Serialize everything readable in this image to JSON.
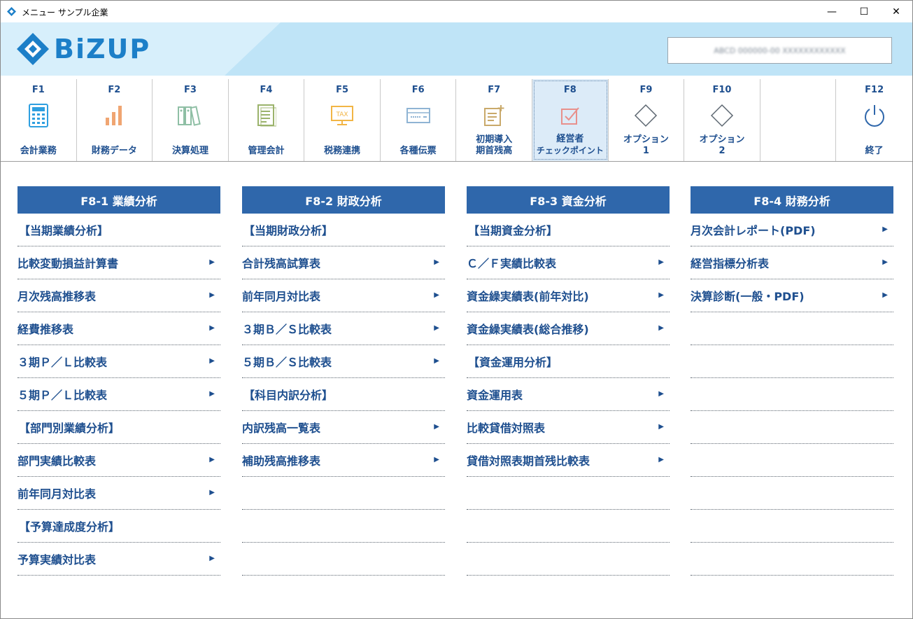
{
  "window": {
    "title": "メニュー サンプル企業",
    "controls": {
      "minimize": "—",
      "maximize": "☐",
      "close": "✕"
    }
  },
  "header": {
    "logo_text": "BiZUP",
    "user_info": "ABCD 000000-00 XXXXXXXXXXXX"
  },
  "fkeys": [
    {
      "key": "F1",
      "label": "会計業務",
      "icon": "calculator-icon"
    },
    {
      "key": "F2",
      "label": "財務データ",
      "icon": "bar-chart-icon"
    },
    {
      "key": "F3",
      "label": "決算処理",
      "icon": "binders-icon"
    },
    {
      "key": "F4",
      "label": "管理会計",
      "icon": "document-icon"
    },
    {
      "key": "F5",
      "label": "税務連携",
      "icon": "tax-monitor-icon"
    },
    {
      "key": "F6",
      "label": "各種伝票",
      "icon": "voucher-icon"
    },
    {
      "key": "F7",
      "label_line1": "初期導入",
      "label_line2": "期首残高",
      "icon": "list-add-icon"
    },
    {
      "key": "F8",
      "label_line1": "経営者",
      "label_line2": "チェックポイント",
      "icon": "checkbox-icon"
    },
    {
      "key": "F9",
      "label_line1": "オプション",
      "label_line2": "1",
      "icon": "diamond-icon"
    },
    {
      "key": "F10",
      "label_line1": "オプション",
      "label_line2": "2",
      "icon": "diamond-icon"
    },
    {
      "key": "F12",
      "label": "終了",
      "icon": "power-icon"
    }
  ],
  "colors": {
    "accent": "#2f67ab",
    "text": "#1e4f8f",
    "header_bg": "#bfe4f7",
    "active_bg": "#dcebf8"
  },
  "columns": [
    {
      "title": "F8-1 業績分析",
      "rows": [
        {
          "label": "【当期業績分析】",
          "section": true
        },
        {
          "label": "比較変動損益計算書",
          "arrow": "▶"
        },
        {
          "label": "月次残高推移表",
          "arrow": "▶"
        },
        {
          "label": "経費推移表",
          "arrow": "▶"
        },
        {
          "label": "３期Ｐ／Ｌ比較表",
          "arrow": "▶"
        },
        {
          "label": "５期Ｐ／Ｌ比較表",
          "arrow": "▶"
        },
        {
          "label": "【部門別業績分析】",
          "section": true
        },
        {
          "label": "部門実績比較表",
          "arrow": "▶"
        },
        {
          "label": "前年同月対比表",
          "arrow": "▶"
        },
        {
          "label": "【予算達成度分析】",
          "section": true
        },
        {
          "label": "予算実績対比表",
          "arrow": "▶"
        }
      ]
    },
    {
      "title": "F8-2 財政分析",
      "rows": [
        {
          "label": "【当期財政分析】",
          "section": true
        },
        {
          "label": "合計残高試算表",
          "arrow": "▶"
        },
        {
          "label": "前年同月対比表",
          "arrow": "▶"
        },
        {
          "label": "３期Ｂ／Ｓ比較表",
          "arrow": "▶"
        },
        {
          "label": "５期Ｂ／Ｓ比較表",
          "arrow": "▶"
        },
        {
          "label": "【科目内訳分析】",
          "section": true
        },
        {
          "label": "内訳残高一覧表",
          "arrow": "▶"
        },
        {
          "label": "補助残高推移表",
          "arrow": "▶"
        },
        {
          "label": ""
        },
        {
          "label": ""
        },
        {
          "label": ""
        }
      ]
    },
    {
      "title": "F8-3 資金分析",
      "rows": [
        {
          "label": "【当期資金分析】",
          "section": true
        },
        {
          "label": "Ｃ／Ｆ実績比較表",
          "arrow": "▶"
        },
        {
          "label": "資金繰実績表(前年対比)",
          "arrow": "▶"
        },
        {
          "label": "資金繰実績表(総合推移)",
          "arrow": "▶"
        },
        {
          "label": "【資金運用分析】",
          "section": true
        },
        {
          "label": "資金運用表",
          "arrow": "▶"
        },
        {
          "label": "比較貸借対照表",
          "arrow": "▶"
        },
        {
          "label": "貸借対照表期首残比較表",
          "arrow": "▶"
        },
        {
          "label": ""
        },
        {
          "label": ""
        },
        {
          "label": ""
        }
      ]
    },
    {
      "title": "F8-4 財務分析",
      "rows": [
        {
          "label": "月次会計レポート(PDF)",
          "arrow": "▶"
        },
        {
          "label": "経営指標分析表",
          "arrow": "▶"
        },
        {
          "label": "決算診断(一般・PDF)",
          "arrow": "▶"
        },
        {
          "label": ""
        },
        {
          "label": ""
        },
        {
          "label": ""
        },
        {
          "label": ""
        },
        {
          "label": ""
        },
        {
          "label": ""
        },
        {
          "label": ""
        },
        {
          "label": ""
        }
      ]
    }
  ]
}
